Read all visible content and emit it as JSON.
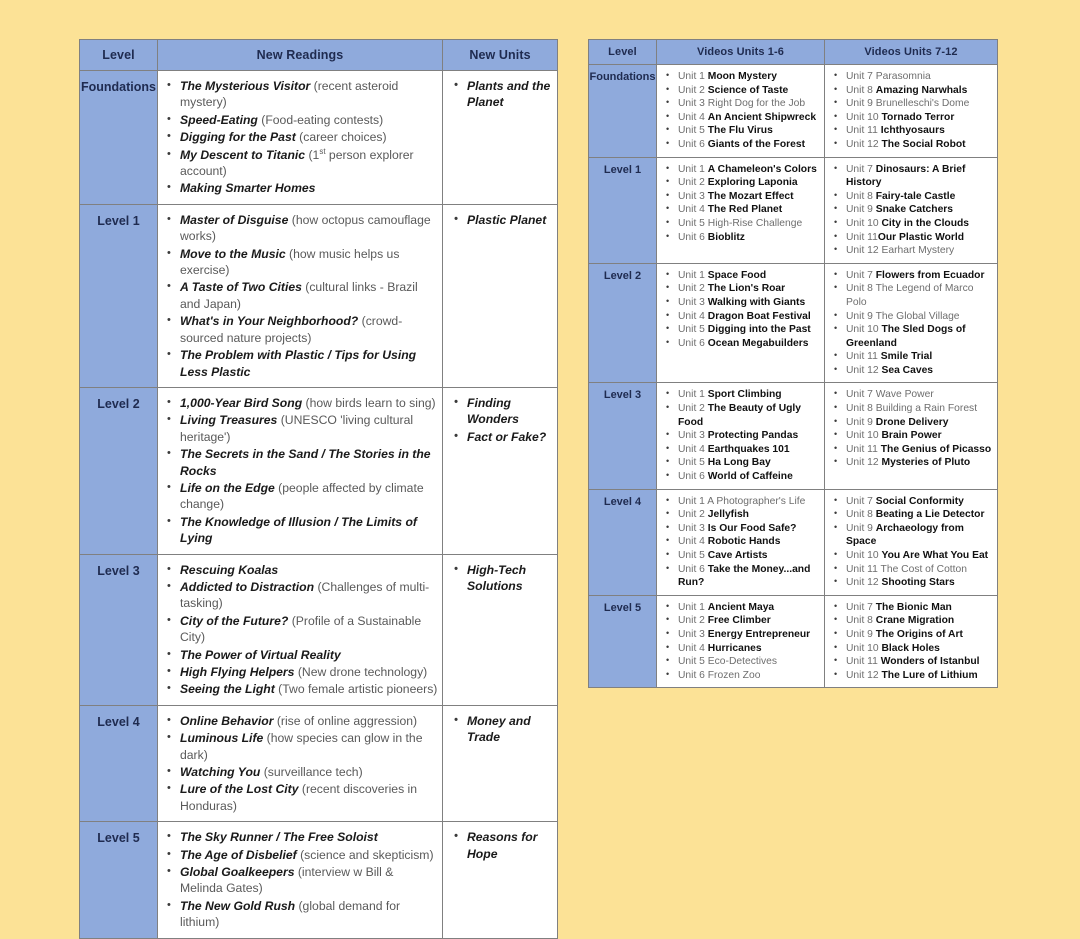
{
  "readings_table": {
    "headers": [
      "Level",
      "New Readings",
      "New Units"
    ],
    "rows": [
      {
        "level": "Foundations",
        "readings": [
          {
            "title": "The Mysterious Visitor",
            "note": " (recent asteroid mystery)"
          },
          {
            "title": "Speed-Eating",
            "note": " (Food-eating contests)"
          },
          {
            "title": "Digging for the Past",
            "note": " (career choices)"
          },
          {
            "title": "My Descent to Titanic",
            "note": " (1st person explorer account)",
            "sup": "st"
          },
          {
            "title": "Making Smarter Homes",
            "note": ""
          }
        ],
        "units": [
          "Plants and the Planet"
        ]
      },
      {
        "level": "Level 1",
        "readings": [
          {
            "title": "Master of Disguise",
            "note": " (how octopus camouflage works)"
          },
          {
            "title": "Move to the Music",
            "note": " (how music helps us exercise)"
          },
          {
            "title": "A Taste of Two Cities",
            "note": " (cultural links - Brazil and Japan)"
          },
          {
            "title": "What's in Your Neighborhood?",
            "note": " (crowd-sourced nature projects)"
          },
          {
            "title": "The Problem with Plastic / Tips for Using Less Plastic",
            "note": ""
          }
        ],
        "units": [
          "Plastic Planet"
        ]
      },
      {
        "level": "Level 2",
        "readings": [
          {
            "title": "1,000-Year Bird Song",
            "note": " (how birds learn to sing)"
          },
          {
            "title": "Living Treasures",
            "note": " (UNESCO 'living cultural heritage')"
          },
          {
            "title": "The Secrets in the Sand / The Stories in the Rocks",
            "note": ""
          },
          {
            "title": "Life on the Edge",
            "note": " (people affected by climate change)"
          },
          {
            "title": "The Knowledge of Illusion / The Limits of Lying",
            "note": ""
          }
        ],
        "units": [
          "Finding Wonders",
          "Fact or Fake?"
        ]
      },
      {
        "level": "Level 3",
        "readings": [
          {
            "title": "Rescuing Koalas",
            "note": ""
          },
          {
            "title": "Addicted to Distraction",
            "note": " (Challenges of multi-tasking)"
          },
          {
            "title": "City of the Future?",
            "note": " (Profile of a Sustainable City)"
          },
          {
            "title": "The Power of Virtual Reality",
            "note": ""
          },
          {
            "title": "High Flying Helpers",
            "note": " (New drone technology)"
          },
          {
            "title": "Seeing the Light",
            "note": " (Two female artistic pioneers)"
          }
        ],
        "units": [
          "High-Tech Solutions"
        ]
      },
      {
        "level": "Level 4",
        "readings": [
          {
            "title": "Online Behavior",
            "note": " (rise of online aggression)"
          },
          {
            "title": "Luminous Life",
            "note": " (how species can glow in the dark)"
          },
          {
            "title": "Watching You",
            "note": " (surveillance tech)"
          },
          {
            "title": "Lure of the Lost City",
            "note": " (recent discoveries in Honduras)"
          }
        ],
        "units": [
          "Money and Trade"
        ]
      },
      {
        "level": "Level 5",
        "readings": [
          {
            "title": "The Sky Runner / The Free Soloist",
            "note": ""
          },
          {
            "title": "The Age of Disbelief",
            "note": " (science and skepticism)"
          },
          {
            "title": "Global Goalkeepers",
            "note": " (interview w Bill & Melinda Gates)"
          },
          {
            "title": "The New Gold Rush",
            "note": " (global demand for lithium)"
          }
        ],
        "units": [
          "Reasons for Hope"
        ]
      }
    ]
  },
  "videos_table": {
    "headers": [
      "Level",
      "Videos Units 1-6",
      "Videos Units 7-12"
    ],
    "rows": [
      {
        "level": "Foundations",
        "units_1_6": [
          {
            "unit": "Unit 1 ",
            "title": "Moon Mystery",
            "bold": true
          },
          {
            "unit": "Unit 2 ",
            "title": "Science of Taste",
            "bold": true
          },
          {
            "unit": "Unit 3 ",
            "title": "Right Dog for the Job",
            "bold": false
          },
          {
            "unit": "Unit 4 ",
            "title": "An Ancient Shipwreck",
            "bold": true
          },
          {
            "unit": "Unit 5 ",
            "title": "The Flu Virus",
            "bold": true
          },
          {
            "unit": "Unit 6 ",
            "title": "Giants of the Forest",
            "bold": true
          }
        ],
        "units_7_12": [
          {
            "unit": "Unit 7 ",
            "title": "Parasomnia",
            "bold": false
          },
          {
            "unit": "Unit 8 ",
            "title": "Amazing Narwhals",
            "bold": true
          },
          {
            "unit": "Unit 9 ",
            "title": "Brunelleschi's Dome",
            "bold": false
          },
          {
            "unit": "Unit 10 ",
            "title": "Tornado Terror",
            "bold": true
          },
          {
            "unit": "Unit 11 ",
            "title": "Ichthyosaurs",
            "bold": true
          },
          {
            "unit": "Unit 12 ",
            "title": "The Social Robot",
            "bold": true
          }
        ]
      },
      {
        "level": "Level 1",
        "units_1_6": [
          {
            "unit": "Unit 1 ",
            "title": "A Chameleon's Colors",
            "bold": true
          },
          {
            "unit": "Unit 2 ",
            "title": "Exploring Laponia",
            "bold": true
          },
          {
            "unit": "Unit 3 ",
            "title": "The Mozart Effect",
            "bold": true
          },
          {
            "unit": "Unit 4 ",
            "title": "The Red Planet",
            "bold": true
          },
          {
            "unit": "Unit 5 ",
            "title": "High-Rise Challenge",
            "bold": false
          },
          {
            "unit": "Unit 6 ",
            "title": "Bioblitz",
            "bold": true
          }
        ],
        "units_7_12": [
          {
            "unit": "Unit 7 ",
            "title": "Dinosaurs: A Brief History",
            "bold": true
          },
          {
            "unit": "Unit 8 ",
            "title": "Fairy-tale Castle",
            "bold": true
          },
          {
            "unit": "Unit 9 ",
            "title": "Snake Catchers",
            "bold": true
          },
          {
            "unit": "Unit 10 ",
            "title": "City in the Clouds",
            "bold": true
          },
          {
            "unit": "Unit 11",
            "title": "Our Plastic World",
            "bold": true
          },
          {
            "unit": "Unit 12 ",
            "title": "Earhart Mystery",
            "bold": false
          }
        ]
      },
      {
        "level": "Level 2",
        "units_1_6": [
          {
            "unit": "Unit 1 ",
            "title": "Space Food",
            "bold": true
          },
          {
            "unit": "Unit 2 ",
            "title": "The Lion's Roar",
            "bold": true
          },
          {
            "unit": "Unit 3 ",
            "title": "Walking with Giants",
            "bold": true
          },
          {
            "unit": "Unit 4 ",
            "title": "Dragon Boat Festival",
            "bold": true
          },
          {
            "unit": "Unit 5 ",
            "title": "Digging into the Past",
            "bold": true
          },
          {
            "unit": "Unit 6 ",
            "title": "Ocean Megabuilders",
            "bold": true
          }
        ],
        "units_7_12": [
          {
            "unit": "Unit 7 ",
            "title": "Flowers from Ecuador",
            "bold": true
          },
          {
            "unit": "Unit 8 ",
            "title": "The Legend of Marco Polo",
            "bold": false
          },
          {
            "unit": "Unit 9 ",
            "title": "The Global Village",
            "bold": false
          },
          {
            "unit": "Unit 10 ",
            "title": "The Sled Dogs of Greenland",
            "bold": true
          },
          {
            "unit": "Unit 11 ",
            "title": "Smile Trial",
            "bold": true
          },
          {
            "unit": "Unit 12 ",
            "title": "Sea Caves",
            "bold": true
          }
        ]
      },
      {
        "level": "Level 3",
        "units_1_6": [
          {
            "unit": "Unit 1 ",
            "title": "Sport Climbing",
            "bold": true
          },
          {
            "unit": "Unit 2 ",
            "title": "The Beauty of Ugly Food",
            "bold": true
          },
          {
            "unit": "Unit 3 ",
            "title": "Protecting Pandas",
            "bold": true
          },
          {
            "unit": "Unit 4 ",
            "title": "Earthquakes 101",
            "bold": true
          },
          {
            "unit": "Unit 5 ",
            "title": "Ha Long Bay",
            "bold": true
          },
          {
            "unit": "Unit 6 ",
            "title": "World of Caffeine",
            "bold": true
          }
        ],
        "units_7_12": [
          {
            "unit": "Unit 7 ",
            "title": "Wave Power",
            "bold": false
          },
          {
            "unit": "Unit 8 ",
            "title": "Building a Rain Forest",
            "bold": false
          },
          {
            "unit": "Unit 9 ",
            "title": "Drone Delivery",
            "bold": true
          },
          {
            "unit": "Unit 10 ",
            "title": "Brain Power",
            "bold": true
          },
          {
            "unit": "Unit 11 ",
            "title": "The Genius of Picasso",
            "bold": true
          },
          {
            "unit": "Unit 12 ",
            "title": "Mysteries of Pluto",
            "bold": true
          }
        ]
      },
      {
        "level": "Level 4",
        "units_1_6": [
          {
            "unit": "Unit 1 ",
            "title": "A Photographer's Life",
            "bold": false
          },
          {
            "unit": "Unit 2 ",
            "title": "Jellyfish",
            "bold": true
          },
          {
            "unit": "Unit 3 ",
            "title": "Is Our Food Safe?",
            "bold": true
          },
          {
            "unit": "Unit 4 ",
            "title": "Robotic Hands",
            "bold": true
          },
          {
            "unit": "Unit 5 ",
            "title": "Cave Artists",
            "bold": true
          },
          {
            "unit": "Unit 6 ",
            "title": "Take the Money...and Run?",
            "bold": true
          }
        ],
        "units_7_12": [
          {
            "unit": "Unit 7 ",
            "title": "Social Conformity",
            "bold": true
          },
          {
            "unit": "Unit 8 ",
            "title": "Beating a Lie Detector",
            "bold": true
          },
          {
            "unit": "Unit 9 ",
            "title": "Archaeology from Space",
            "bold": true
          },
          {
            "unit": "Unit 10 ",
            "title": "You Are What You Eat",
            "bold": true
          },
          {
            "unit": "Unit 11 ",
            "title": "The Cost of Cotton",
            "bold": false
          },
          {
            "unit": "Unit 12 ",
            "title": "Shooting Stars",
            "bold": true
          }
        ]
      },
      {
        "level": "Level 5",
        "units_1_6": [
          {
            "unit": "Unit 1 ",
            "title": "Ancient Maya",
            "bold": true
          },
          {
            "unit": "Unit 2 ",
            "title": "Free Climber",
            "bold": true
          },
          {
            "unit": "Unit 3 ",
            "title": "Energy Entrepreneur",
            "bold": true
          },
          {
            "unit": "Unit 4 ",
            "title": "Hurricanes",
            "bold": true
          },
          {
            "unit": "Unit 5 ",
            "title": "Eco-Detectives",
            "bold": false
          },
          {
            "unit": "Unit 6 ",
            "title": "Frozen Zoo",
            "bold": false
          }
        ],
        "units_7_12": [
          {
            "unit": "Unit 7 ",
            "title": "The Bionic Man",
            "bold": true
          },
          {
            "unit": "Unit 8 ",
            "title": "Crane Migration",
            "bold": true
          },
          {
            "unit": "Unit 9 ",
            "title": "The Origins of Art",
            "bold": true
          },
          {
            "unit": "Unit 10 ",
            "title": "Black Holes",
            "bold": true
          },
          {
            "unit": "Unit 11 ",
            "title": "Wonders of Istanbul",
            "bold": true
          },
          {
            "unit": "Unit 12 ",
            "title": "The Lure of Lithium",
            "bold": true
          }
        ]
      }
    ]
  },
  "colors": {
    "background": "#FCE296",
    "header_blue": "#8FAADC",
    "border_gray": "#808080",
    "title_text": "#1A1A1A",
    "note_text": "#595959"
  }
}
